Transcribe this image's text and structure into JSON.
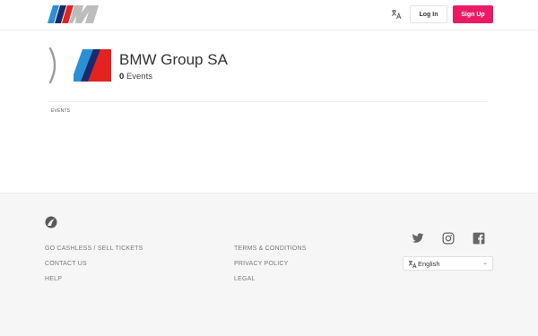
{
  "header": {
    "login_label": "Log In",
    "signup_label": "Sign Up",
    "translate_icon": "translate-icon",
    "brand_colors": [
      "#0d5cab",
      "#1b2a6b",
      "#e4221f",
      "#bdbdbd"
    ],
    "accent": "#ec1a64"
  },
  "organizer": {
    "name": "BMW Group SA",
    "events_count": "0",
    "events_word": "Events"
  },
  "main": {
    "section_label": "EVENTS"
  },
  "footer": {
    "col1": [
      "GO CASHLESS / SELL TICKETS",
      "CONTACT US",
      "HELP"
    ],
    "col2": [
      "TERMS & CONDITIONS",
      "PRIVACY POLICY",
      "LEGAL"
    ],
    "social_icons": [
      "twitter-icon",
      "instagram-icon",
      "facebook-icon"
    ],
    "language": {
      "selected": "English",
      "icon": "translate-icon"
    }
  }
}
